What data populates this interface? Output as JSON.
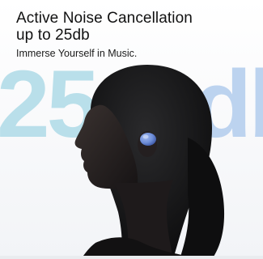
{
  "headline": {
    "line1": "Active Noise Cancellation",
    "line2": "up to 25db"
  },
  "subheadline": "Immerse Yourself in Music.",
  "background_text": {
    "number": "25",
    "unit": "db"
  },
  "image": {
    "subject": "woman-wearing-wireless-earbud",
    "earbud_color": "#6f8fd8"
  },
  "colors": {
    "number_tint": "#b9dfea",
    "unit_tint": "#bcd3ef",
    "text": "#111111"
  }
}
